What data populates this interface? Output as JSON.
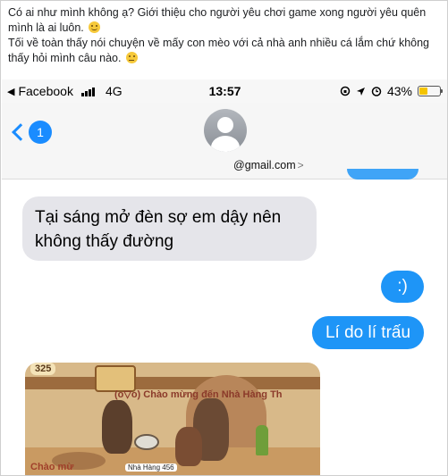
{
  "post": {
    "line1": "Có ai như mình không ạ? Giới thiệu cho người yêu chơi game xong người yêu quên mình là ai luôn.",
    "line2": "Tối về toàn thấy nói chuyện về mấy con mèo với cả nhà anh nhiều cá lắm chứ không thấy hỏi mình câu nào.",
    "emoji1": "smile-emoji",
    "emoji2": "eye-roll-emoji"
  },
  "statusbar": {
    "back_app": "Facebook",
    "network": "4G",
    "time": "13:57",
    "battery_percent": "43%",
    "battery_level": 0.43,
    "battery_color": "#f4c400"
  },
  "conversation": {
    "unread_count": "1",
    "contact_email": "@gmail.com",
    "messages": [
      {
        "direction": "incoming",
        "text": "Tại sáng mở đèn sợ em dậy nên không thấy đường"
      },
      {
        "direction": "outgoing",
        "text": ":)"
      },
      {
        "direction": "outgoing",
        "text": "Lí do lí trấu"
      }
    ]
  },
  "attachment": {
    "coins": "325",
    "banner_top": "(o▽o) Chào mừng đến Nhà Hàng Th",
    "banner_bottom": "Chào mừ",
    "label_small": "Nhà Hàng 456"
  },
  "colors": {
    "ios_blue": "#1a8cff",
    "bubble_out": "#1e95f7",
    "bubble_in": "#e5e5ea"
  }
}
